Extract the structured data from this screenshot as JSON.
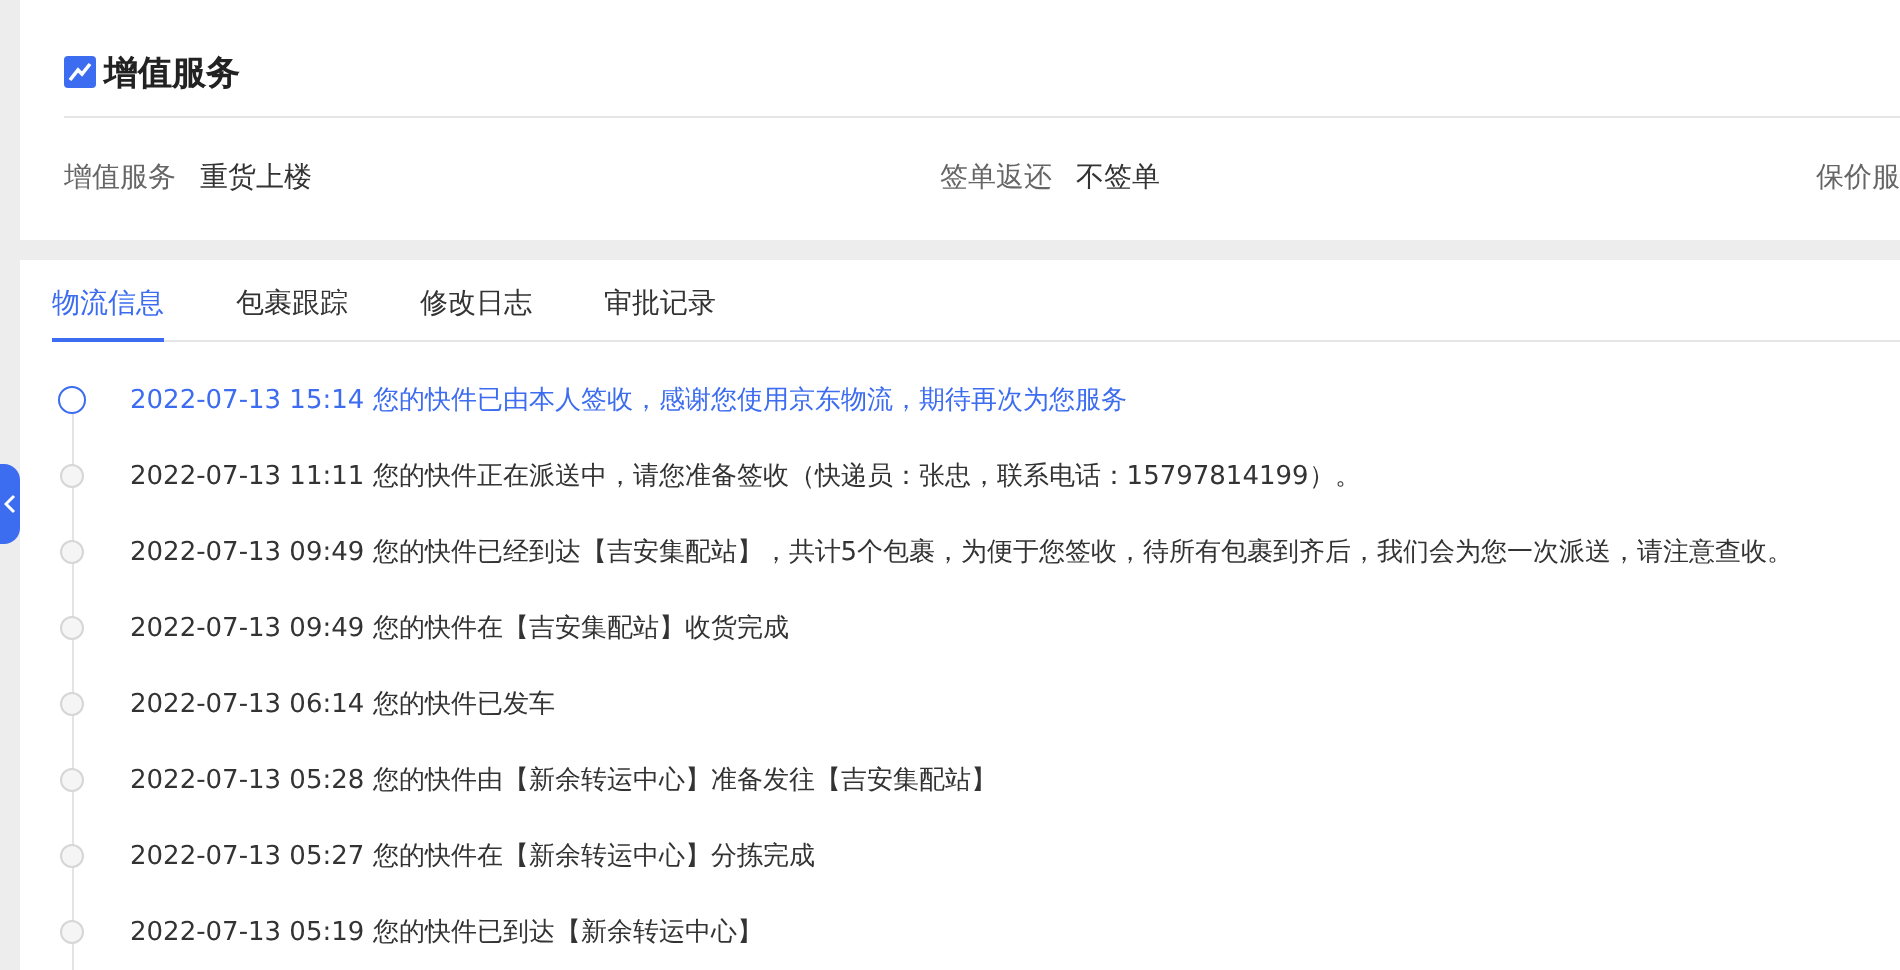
{
  "service_card": {
    "title": "增值服务",
    "fields": [
      {
        "label": "增值服务",
        "value": "重货上楼"
      },
      {
        "label": "签单返还",
        "value": "不签单"
      },
      {
        "label": "保价服"
      }
    ]
  },
  "tabs": [
    {
      "label": "物流信息",
      "selected": true
    },
    {
      "label": "包裹跟踪",
      "selected": false
    },
    {
      "label": "修改日志",
      "selected": false
    },
    {
      "label": "审批记录",
      "selected": false
    }
  ],
  "timeline": [
    {
      "time": "2022-07-13 15:14",
      "text": "您的快件已由本人签收，感谢您使用京东物流，期待再次为您服务",
      "active": true
    },
    {
      "time": "2022-07-13 11:11",
      "text": "您的快件正在派送中，请您准备签收（快递员：张忠，联系电话：15797814199）。",
      "active": false
    },
    {
      "time": "2022-07-13 09:49",
      "text": "您的快件已经到达【吉安集配站】，共计5个包裹，为便于您签收，待所有包裹到齐后，我们会为您一次派送，请注意查收。",
      "active": false
    },
    {
      "time": "2022-07-13 09:49",
      "text": "您的快件在【吉安集配站】收货完成",
      "active": false
    },
    {
      "time": "2022-07-13 06:14",
      "text": "您的快件已发车",
      "active": false
    },
    {
      "time": "2022-07-13 05:28",
      "text": "您的快件由【新余转运中心】准备发往【吉安集配站】",
      "active": false
    },
    {
      "time": "2022-07-13 05:27",
      "text": "您的快件在【新余转运中心】分拣完成",
      "active": false
    },
    {
      "time": "2022-07-13 05:19",
      "text": "您的快件已到达【新余转运中心】",
      "active": false
    }
  ]
}
